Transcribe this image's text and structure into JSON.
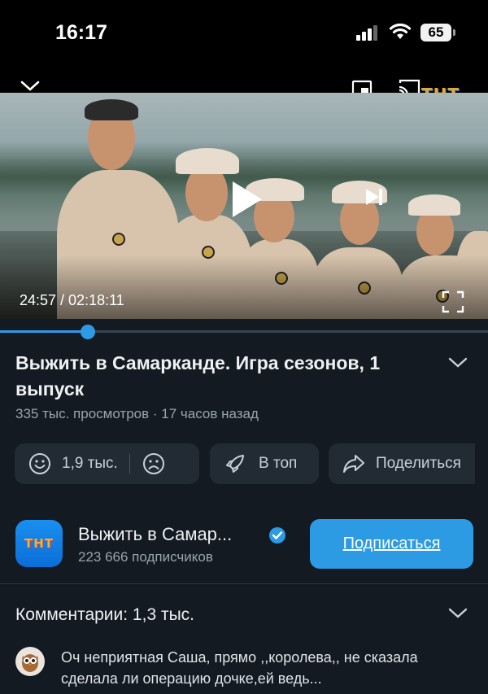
{
  "status_bar": {
    "time": "16:17",
    "battery": "65"
  },
  "player": {
    "channel_watermark": "ТНТ",
    "timecode": "24:57 / 02:18:11",
    "progress": 0.18
  },
  "video": {
    "title": "Выжить в Самарканде. Игра сезонов, 1 выпуск",
    "meta": "335 тыс. просмотров · 17 часов назад"
  },
  "actions": {
    "likes": "1,9 тыс.",
    "top_label": "В топ",
    "share_label": "Поделиться"
  },
  "channel": {
    "logo_text": "ТНТ",
    "name": "Выжить в Самар...",
    "subscribers": "223 666 подписчиков",
    "subscribe_label": "Подписаться"
  },
  "comments": {
    "header": "Комментарии: 1,3  тыс.",
    "first_comment": "Оч неприятная Саша, прямо ,,королева,, не сказала сделала ли операцию дочке,ей ведь..."
  },
  "colors": {
    "accent": "#2d9ae4",
    "background": "#141a22",
    "pill": "#222a34"
  }
}
